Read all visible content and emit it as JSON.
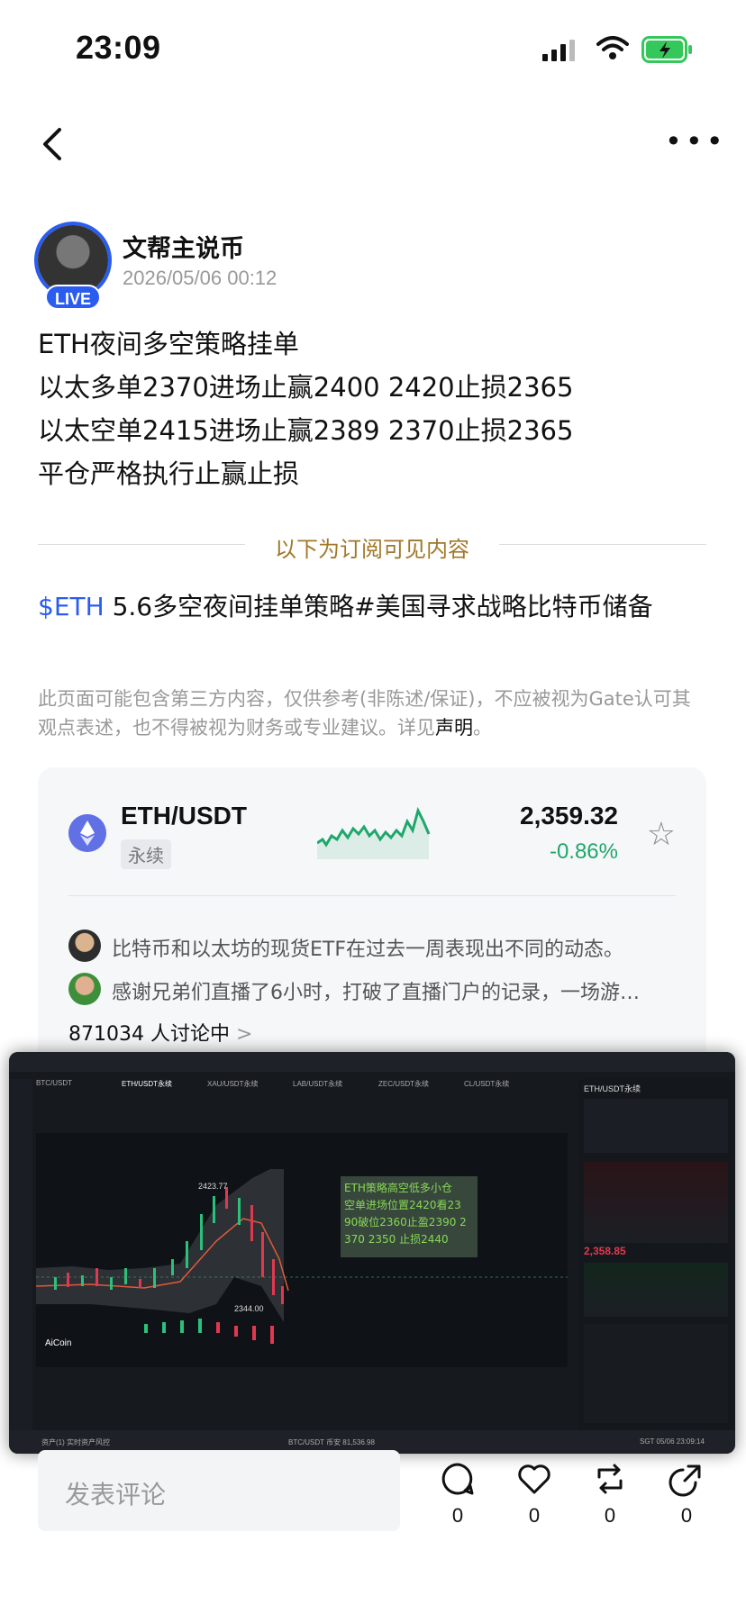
{
  "status_bar": {
    "time": "23:09"
  },
  "author": {
    "name": "文帮主说币",
    "date": "2026/05/06 00:12",
    "live_badge": "LIVE"
  },
  "post": {
    "lines": [
      "ETH夜间多空策略挂单",
      "以太多单2370进场止赢2400 2420止损2365",
      "以太空单2415进场止赢2389 2370止损2365",
      "平仓严格执行止赢止损"
    ]
  },
  "divider_label": "以下为订阅可见内容",
  "topic": {
    "tag": "$ETH",
    "text": " 5.6多空夜间挂单策略#美国寻求战略比特币储备"
  },
  "disclaimer": {
    "text": "此页面可能包含第三方内容，仅供参考(非陈述/保证)，不应被视为Gate认可其观点表述，也不得被视为财务或专业建议。详见",
    "link": "声明",
    "end": "。"
  },
  "market": {
    "pair": "ETH/USDT",
    "type": "永续",
    "price": "2,359.32",
    "change": "-0.86%",
    "color_down": "#1fa76b",
    "discussions": [
      "比特币和以太坊的现货ETF在过去一周表现出不同的动态。",
      "感谢兄弟们直播了6小时，打破了直播门户的记录，一场游…"
    ],
    "discussion_count": "871034 人讨论中",
    "chevron": ">"
  },
  "terminal": {
    "tabs": [
      "BTC/USDT",
      "ETH/USDT永续",
      "XAU/USDT永续",
      "LAB/USDT永续",
      "ZEC/USDT永续",
      "CL/USDT永续"
    ],
    "pair_title": "ETH/USDT永续",
    "annotation": [
      "ETH策略高空低多小仓",
      "空单进场位置2420看23",
      "90破位2360止盈2390 2",
      "370 2350 止损2440"
    ],
    "high_label": "2423.77",
    "low_label": "2344.00",
    "price_big": "2,358.85",
    "aicoin": "AiCoin",
    "bottom_left": "资产(1)   实时资产风控",
    "bottom_mid": "BTC/USDT 币安  81,536.98",
    "bottom_right": "SGT 05/06 23:09:14"
  },
  "bottom_bar": {
    "comment_placeholder": "发表评论",
    "counts": {
      "comment": "0",
      "like": "0",
      "repost": "0",
      "share": "0"
    }
  }
}
